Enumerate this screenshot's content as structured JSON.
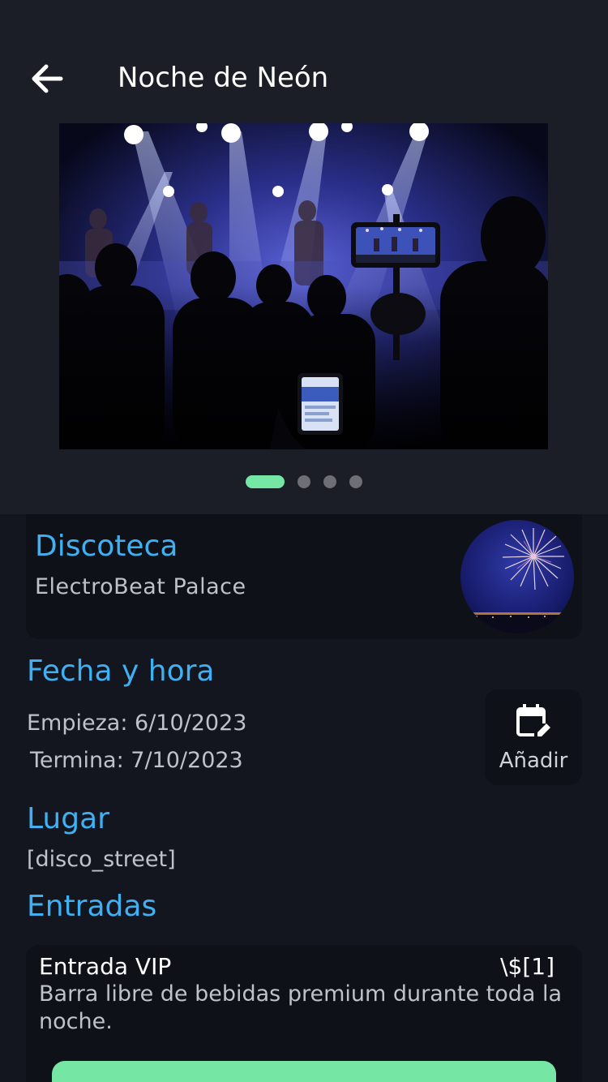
{
  "header": {
    "title": "Noche de Neón",
    "back_icon": "arrow-left-icon"
  },
  "carousel": {
    "image": "concert-crowd-photo",
    "page_count": 4,
    "active_index": 0,
    "active_color": "#76e6a5"
  },
  "venue": {
    "type": "Discoteca",
    "name": "ElectroBeat Palace",
    "thumbnail": "fireworks-photo"
  },
  "schedule": {
    "heading": "Fecha y hora",
    "start": "Empieza: 6/10/2023",
    "end": "Termina: 7/10/2023",
    "add_label": "Añadir",
    "add_icon": "calendar-edit-icon"
  },
  "location": {
    "heading": "Lugar",
    "value": "[disco_street]"
  },
  "tickets": {
    "heading": "Entradas",
    "items": [
      {
        "name": "Entrada VIP",
        "price": "\\$[1]",
        "description": "Barra libre de bebidas premium durante toda la noche."
      }
    ]
  },
  "colors": {
    "accent": "#3fb1f3",
    "primary_button": "#76e6a5",
    "background": "#13161f",
    "card": "#0e1117"
  }
}
